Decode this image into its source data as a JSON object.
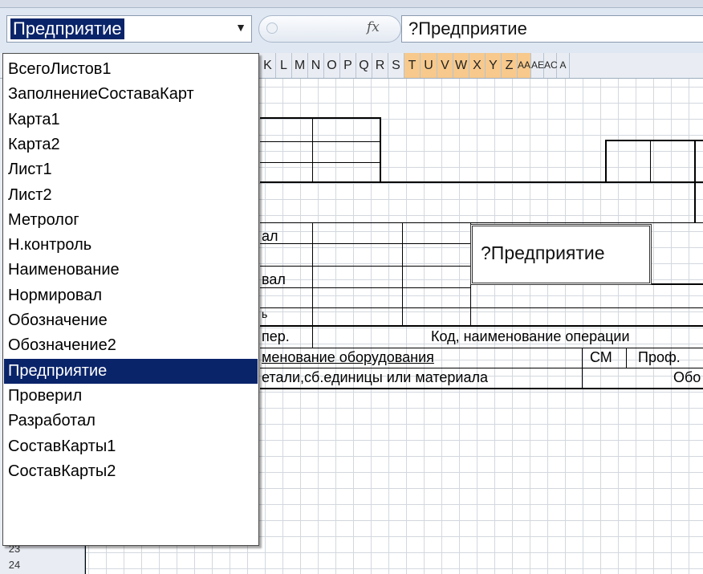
{
  "name_box": {
    "value": "Предприятие"
  },
  "formula_bar": {
    "fx_label": "fx",
    "content": "?Предприятие"
  },
  "column_headers": [
    "K",
    "L",
    "M",
    "N",
    "O",
    "P",
    "Q",
    "R",
    "S",
    "T",
    "U",
    "V",
    "W",
    "X",
    "Y",
    "Z",
    "AA",
    "AE",
    "AC",
    "A"
  ],
  "selected_columns": [
    "T",
    "U",
    "V",
    "W",
    "X",
    "Y",
    "Z",
    "AA"
  ],
  "row_headers": [
    "23",
    "24"
  ],
  "defined_names": [
    "ВсегоЛистов1",
    "ЗаполнениеСоставаКарт",
    "Карта1",
    "Карта2",
    "Лист1",
    "Лист2",
    "Метролог",
    "Н.контроль",
    "Наименование",
    "Нормировал",
    "Обозначение",
    "Обозначение2",
    "Предприятие",
    "Проверил",
    "Разработал",
    "СоставКарты1",
    "СоставКарты2"
  ],
  "selected_name": "Предприятие",
  "sheet": {
    "name_cell": "?Предприятие",
    "fragments": {
      "al1": "ал",
      "al2": "вал",
      "b": "ь",
      "oper": "пер.",
      "code_op": "Код, наименование операции",
      "equip": "менование оборудования",
      "cm": "СМ",
      "prof": "Проф.",
      "detail": "етали,сб.единицы или материала",
      "obo": "Обо"
    }
  },
  "colors": {
    "selection": "#0a246a",
    "header_selected": "#f7c98c"
  }
}
